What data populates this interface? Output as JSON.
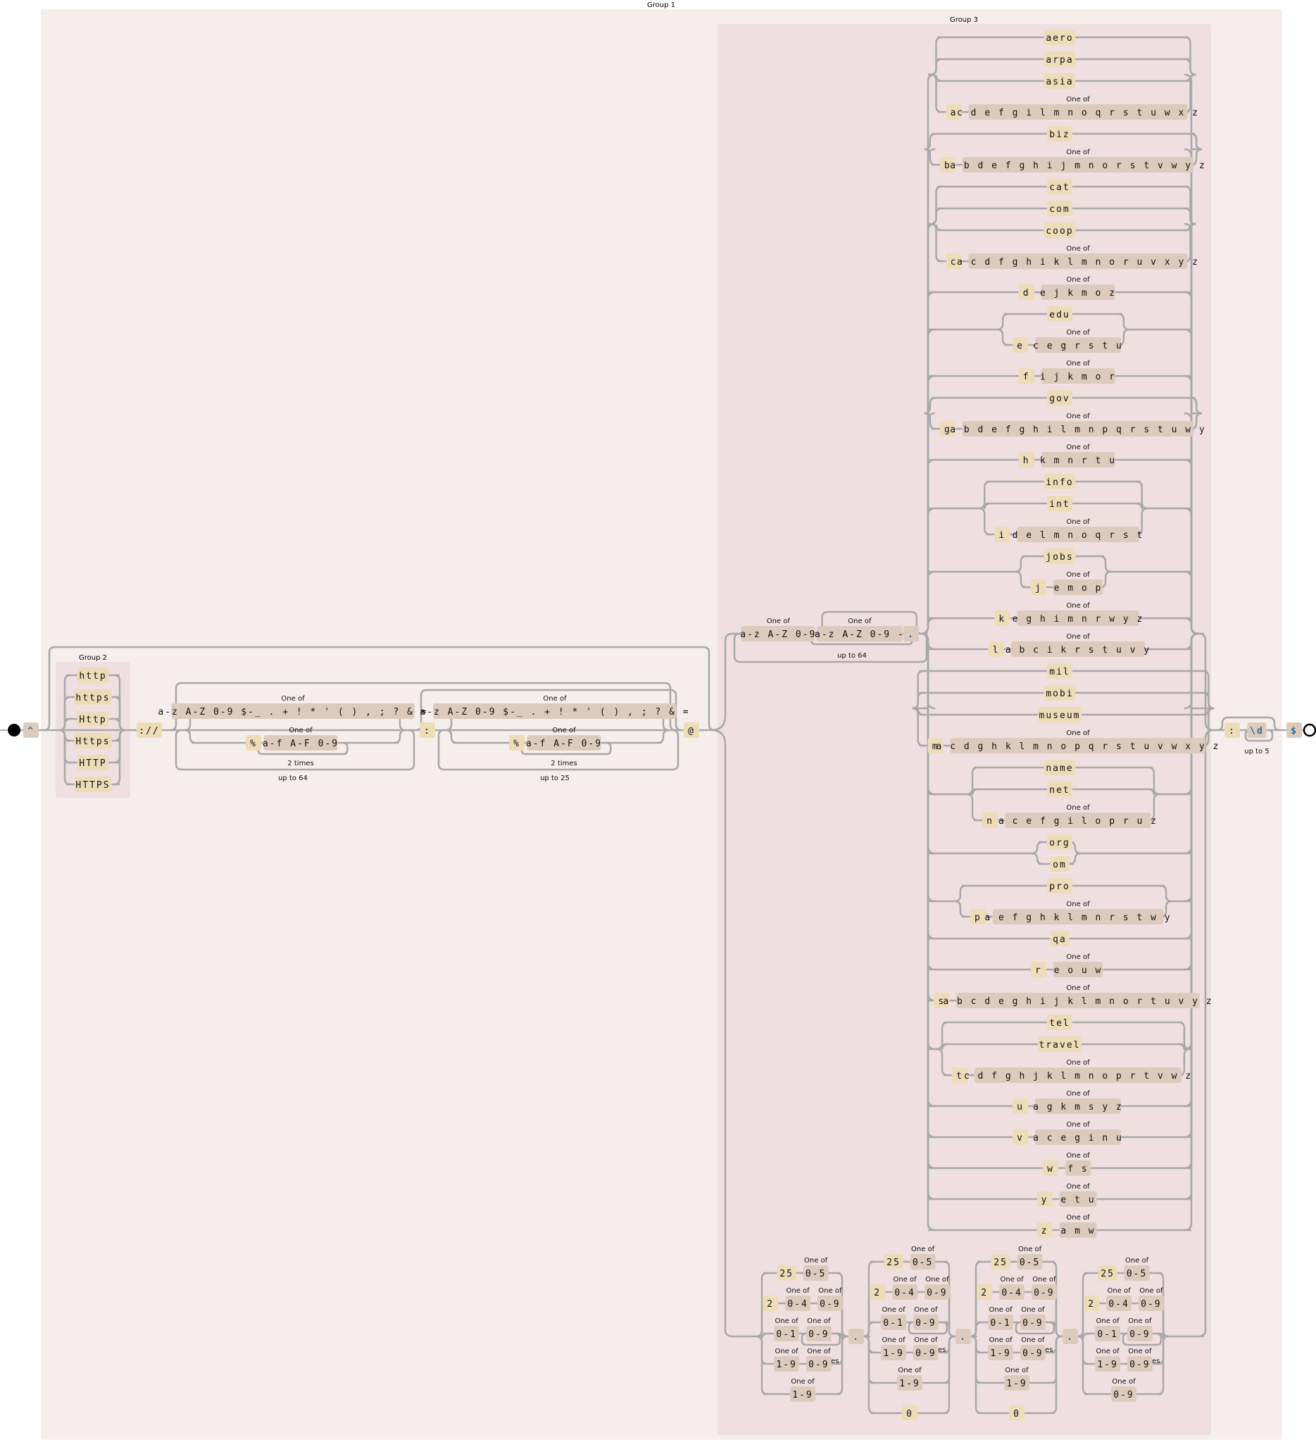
{
  "groups": {
    "group1": "Group 1",
    "group2": "Group 2",
    "group3": "Group 3"
  },
  "labels": {
    "one_of": "One of",
    "two_times": "2 times",
    "up_to_64": "up to 64",
    "up_to_25": "up to 25",
    "up_to_5": "up to 5"
  },
  "anchors": {
    "start": "^",
    "end": "$"
  },
  "scheme": {
    "alternatives": [
      "http",
      "https",
      "Http",
      "Https",
      "HTTP",
      "HTTPS"
    ],
    "separator": "://"
  },
  "userinfo": {
    "user_charset": "a-z A-Z 0-9 $-_ . + ! * ' ( ) , ; ? & =",
    "percent": "%",
    "hex_charset": "a-f A-F 0-9",
    "user_repeat": "up to 64",
    "colon": ":",
    "pass_charset": "a-z A-Z 0-9 $-_ . + ! * ' ( ) , ; ? & =",
    "pass_repeat": "up to 25",
    "at": "@"
  },
  "hostname": {
    "first_charset": "a-z A-Z 0-9",
    "rest_charset": "a-z A-Z 0-9 -",
    "repeat": "up to 64",
    "dot": "."
  },
  "tlds": [
    {
      "words": [
        "aero",
        "arpa",
        "asia"
      ],
      "prefix": "a",
      "set": "c d e f g i l m n o q r s t u w x z"
    },
    {
      "words": [
        "biz"
      ],
      "prefix": "b",
      "set": "a b d e f g h i j m n o r s t v w y z"
    },
    {
      "words": [
        "cat",
        "com",
        "coop"
      ],
      "prefix": "c",
      "set": "a c d f g h i k l m n o r u v x y z"
    },
    {
      "words": [],
      "prefix": "d",
      "set": "e j k m o z"
    },
    {
      "words": [
        "edu"
      ],
      "prefix": "e",
      "set": "c e g r s t u"
    },
    {
      "words": [],
      "prefix": "f",
      "set": "i j k m o r"
    },
    {
      "words": [
        "gov"
      ],
      "prefix": "g",
      "set": "a b d e f g h i l m n p q r s t u w y"
    },
    {
      "words": [],
      "prefix": "h",
      "set": "k m n r t u"
    },
    {
      "words": [
        "info",
        "int"
      ],
      "prefix": "i",
      "set": "d e l m n o q r s t"
    },
    {
      "words": [
        "jobs"
      ],
      "prefix": "j",
      "set": "e m o p"
    },
    {
      "words": [],
      "prefix": "k",
      "set": "e g h i m n r w y z"
    },
    {
      "words": [],
      "prefix": "l",
      "set": "a b c i k r s t u v y"
    },
    {
      "words": [
        "mil",
        "mobi",
        "museum"
      ],
      "prefix": "m",
      "set": "a c d g h k l m n o p q r s t u v w x y z"
    },
    {
      "words": [
        "name",
        "net"
      ],
      "prefix": "n",
      "set": "a c e f g i l o p r u z"
    },
    {
      "words": [
        "org",
        "om"
      ],
      "prefix": null,
      "set": null
    },
    {
      "words": [
        "pro"
      ],
      "prefix": "p",
      "set": "a e f g h k l m n r s t w y"
    },
    {
      "words": [
        "qa"
      ],
      "prefix": null,
      "set": null
    },
    {
      "words": [],
      "prefix": "r",
      "set": "e o u w"
    },
    {
      "words": [],
      "prefix": "s",
      "set": "a b c d e g h i j k l m n o r t u v y z"
    },
    {
      "words": [
        "tel",
        "travel"
      ],
      "prefix": "t",
      "set": "c d f g h j k l m n o p r t v w z"
    },
    {
      "words": [],
      "prefix": "u",
      "set": "a g k m s y z"
    },
    {
      "words": [],
      "prefix": "v",
      "set": "a c e g i n u"
    },
    {
      "words": [],
      "prefix": "w",
      "set": "f s"
    },
    {
      "words": [],
      "prefix": "y",
      "set": "e t u"
    },
    {
      "words": [],
      "prefix": "z",
      "set": "a m w"
    }
  ],
  "ipv4": {
    "dot": ".",
    "octet_first": [
      {
        "lit": "25",
        "sets": [
          "0-5"
        ]
      },
      {
        "lit": "2",
        "sets": [
          "0-4",
          "0-9"
        ]
      },
      {
        "lit": null,
        "sets": [
          "0-1",
          "0-9"
        ],
        "repeat": "2 times"
      },
      {
        "lit": null,
        "sets": [
          "1-9",
          "0-9"
        ]
      },
      {
        "lit": null,
        "sets": [
          "1-9"
        ]
      }
    ],
    "octet_middle": [
      {
        "lit": "25",
        "sets": [
          "0-5"
        ]
      },
      {
        "lit": "2",
        "sets": [
          "0-4",
          "0-9"
        ]
      },
      {
        "lit": null,
        "sets": [
          "0-1",
          "0-9"
        ],
        "repeat": "2 times"
      },
      {
        "lit": null,
        "sets": [
          "1-9",
          "0-9"
        ]
      },
      {
        "lit": null,
        "sets": [
          "1-9"
        ]
      },
      {
        "lit": "0",
        "sets": []
      }
    ],
    "octet_last": [
      {
        "lit": "25",
        "sets": [
          "0-5"
        ]
      },
      {
        "lit": "2",
        "sets": [
          "0-4",
          "0-9"
        ]
      },
      {
        "lit": null,
        "sets": [
          "0-1",
          "0-9"
        ],
        "repeat": "2 times"
      },
      {
        "lit": null,
        "sets": [
          "1-9",
          "0-9"
        ]
      },
      {
        "lit": null,
        "sets": [
          "0-9"
        ]
      }
    ]
  },
  "port": {
    "colon": ":",
    "digit": "\\d",
    "repeat": "up to 5"
  }
}
